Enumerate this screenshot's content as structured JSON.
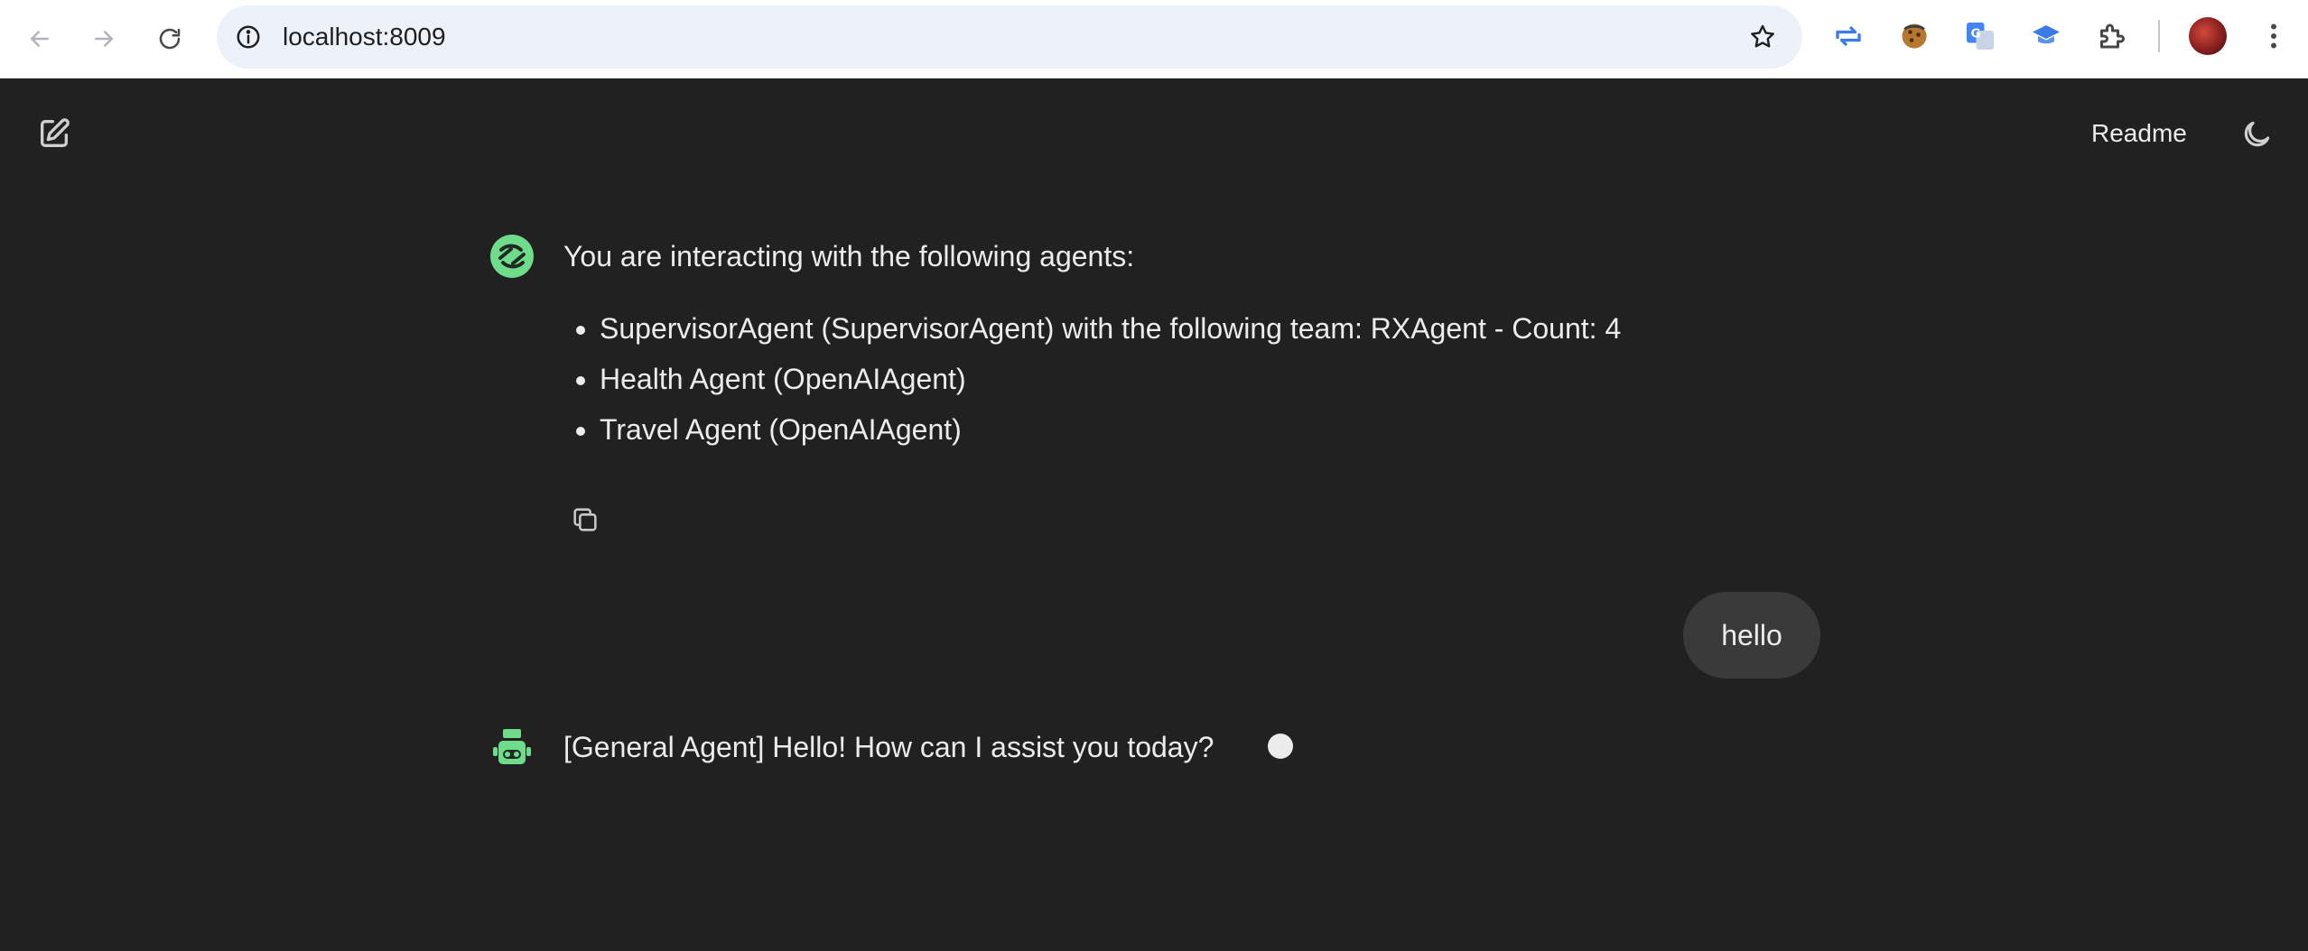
{
  "browser": {
    "url": "localhost:8009"
  },
  "header": {
    "readme_label": "Readme"
  },
  "conversation": {
    "intro": "You are interacting with the following agents:",
    "agents": [
      "SupervisorAgent (SupervisorAgent) with the following team: RXAgent - Count: 4",
      "Health Agent (OpenAIAgent)",
      "Travel Agent (OpenAIAgent)"
    ],
    "user_message": "hello",
    "agent_reply": "[General Agent] Hello! How can I assist you today?"
  },
  "colors": {
    "background": "#212121",
    "text": "#ececec",
    "user_bubble": "#3a3a3a",
    "agent_accent": "#6fdc8c",
    "omnibox": "#edf2fa"
  },
  "icons": {
    "back": "arrow-left-icon",
    "forward": "arrow-right-icon",
    "reload": "reload-icon",
    "site_info": "info-icon",
    "bookmark": "star-icon",
    "new_chat": "pencil-square-icon",
    "theme": "moon-icon",
    "copy": "copy-icon",
    "system_avatar": "swirl-logo-icon",
    "agent_avatar": "robot-icon"
  }
}
